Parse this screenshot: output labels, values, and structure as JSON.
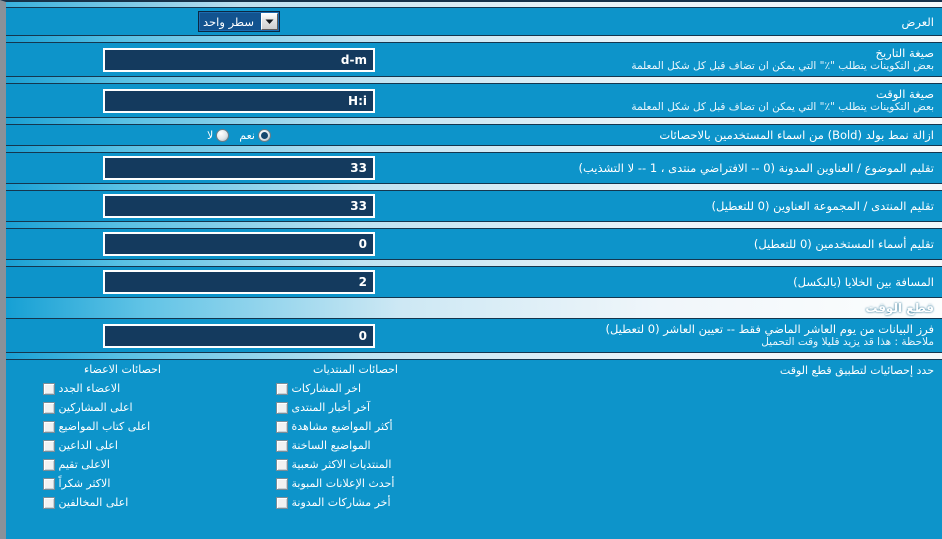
{
  "display_row": {
    "label": "العرض",
    "select_value": "سطر واحد",
    "arrow_icon": "chevron-down-icon"
  },
  "rows": [
    {
      "title": "صيغة التاريخ",
      "desc": "بعض التكوينات يتطلب \"٪\" التي يمكن ان تضاف قبل كل شكل المعلمة",
      "value": "d-m"
    },
    {
      "title": "صيغة الوقت",
      "desc": "بعض التكوينات يتطلب \"٪\" التي يمكن ان تضاف قبل كل شكل المعلمة",
      "value": "H:i"
    }
  ],
  "bold_row": {
    "title": "ازالة نمط بولد (Bold) من اسماء المستخدمين بالاحصائات",
    "options": [
      {
        "label": "نعم",
        "checked": true
      },
      {
        "label": "لا",
        "checked": false
      }
    ]
  },
  "numeric_rows": [
    {
      "title": "تقليم الموضوع / العناوين المدونة (0 -- الافتراضي منتدى ، 1 -- لا التشذيب)",
      "value": "33"
    },
    {
      "title": "تقليم المنتدى / المجموعة العناوين (0 للتعطيل)",
      "value": "33"
    },
    {
      "title": "تقليم أسماء المستخدمين (0 للتعطيل)",
      "value": "0"
    },
    {
      "title": "المسافة بين الخلايا (بالبكسل)",
      "value": "2"
    }
  ],
  "section": {
    "title": "قطع الوقت"
  },
  "cutoff_row": {
    "title": "فرز البيانات من يوم العاشر الماضي فقط -- تعيين العاشر (0 لتعطيل)",
    "desc": "ملاحظة : هذا قد يزيد قليلا وقت التحميل",
    "value": "0"
  },
  "stats_selector": {
    "label": "حدد إحصائيات لتطبيق قطع الوقت",
    "forums_column": {
      "heading": "احصائات المنتديات",
      "items": [
        {
          "label": "اخر المشاركات",
          "checked": false
        },
        {
          "label": "آخر أخبار المنتدى",
          "checked": false
        },
        {
          "label": "أكثر المواضيع مشاهدة",
          "checked": false
        },
        {
          "label": "المواضيع الساخنة",
          "checked": false
        },
        {
          "label": "المنتديات الاكثر شعبية",
          "checked": false
        },
        {
          "label": "أحدث الإعلانات المبوبة",
          "checked": false
        },
        {
          "label": "أخر مشاركات المدونة",
          "checked": false
        }
      ]
    },
    "members_column": {
      "heading": "احصائات الاعضاء",
      "items": [
        {
          "label": "الاعضاء الجدد",
          "checked": false
        },
        {
          "label": "اعلى المشاركين",
          "checked": false
        },
        {
          "label": "اعلى كتاب المواضيع",
          "checked": false
        },
        {
          "label": "اعلى الداعين",
          "checked": false
        },
        {
          "label": "الاعلى تقيم",
          "checked": false
        },
        {
          "label": "الاكثر شكراً",
          "checked": false
        },
        {
          "label": "اعلى المخالفين",
          "checked": false
        }
      ]
    }
  },
  "colors": {
    "background": "#0d94ca",
    "input_background": "#143a5e",
    "input_border": "#ffffff",
    "text": "#ffffff",
    "separator_dark": "#14364f"
  }
}
